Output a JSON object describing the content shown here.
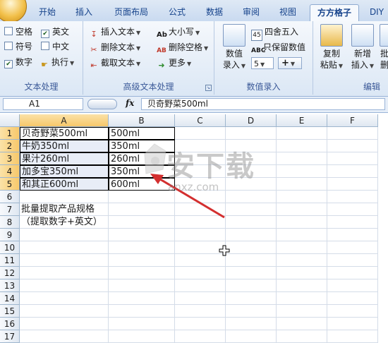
{
  "tabs": [
    "开始",
    "插入",
    "页面布局",
    "公式",
    "数据",
    "审阅",
    "视图",
    "方方格子",
    "DIY"
  ],
  "active_tab": "方方格子",
  "groups": {
    "text_process": {
      "label": "文本处理",
      "checks": [
        {
          "label": "空格",
          "checked": false
        },
        {
          "label": "英文",
          "checked": true
        },
        {
          "label": "符号",
          "checked": false
        },
        {
          "label": "中文",
          "checked": false
        },
        {
          "label": "数字",
          "checked": true
        }
      ],
      "execute": "执行"
    },
    "advanced_text": {
      "label": "高级文本处理",
      "insert_text": "插入文本",
      "delete_text": "删除文本",
      "truncate_text": "截取文本",
      "case": "大小写",
      "delete_space": "删除空格",
      "more": "更多"
    },
    "number_entry": {
      "label": "数值录入",
      "value_entry": [
        "数值",
        "录入"
      ],
      "round": "四舍五入",
      "keep_value": "只保留数值",
      "spinner_value": "5",
      "plus": "+"
    },
    "edit": {
      "label": "编辑",
      "copy_paste": [
        "复制",
        "粘贴"
      ],
      "new_insert": [
        "新增",
        "插入"
      ],
      "more_cut": [
        "批",
        "删"
      ]
    }
  },
  "formula_bar": {
    "name_box": "A1",
    "fx": "fx",
    "content": "贝奇野菜500ml"
  },
  "columns": [
    "A",
    "B",
    "C",
    "D",
    "E",
    "F"
  ],
  "rows": [
    "1",
    "2",
    "3",
    "4",
    "5",
    "6",
    "7",
    "8",
    "9",
    "10",
    "11",
    "12",
    "13",
    "14",
    "15",
    "16",
    "17"
  ],
  "cells": {
    "A": [
      "贝奇野菜500ml",
      "牛奶350ml",
      "果汁260ml",
      "加多宝350ml",
      "和其正600ml",
      "",
      "批量提取产品规格",
      "（提取数字+英文）"
    ],
    "B": [
      "500ml",
      "350ml",
      "260ml",
      "350ml",
      "600ml"
    ]
  },
  "watermark": {
    "brand": "安下载",
    "url": "anxz.com"
  }
}
